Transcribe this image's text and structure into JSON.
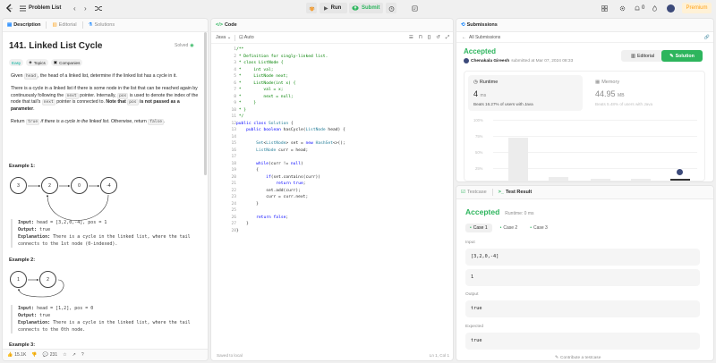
{
  "topbar": {
    "problem_list": "Problem List",
    "run": "Run",
    "submit": "Submit",
    "streak": "0",
    "premium": "Premium"
  },
  "left": {
    "tabs": [
      "Description",
      "Editorial",
      "Solutions"
    ],
    "title": "141. Linked List Cycle",
    "status": "Solved",
    "difficulty": "Easy",
    "chips": [
      "Topics",
      "Companies"
    ],
    "p1_a": "Given ",
    "p1_code": "head",
    "p1_b": ", the head of a linked list, determine if the linked list has a cycle in it.",
    "p2_a": "There is a cycle in a linked list if there is some node in the list that can be reached again by continuously following the ",
    "p2_code1": "next",
    "p2_b": " pointer. Internally, ",
    "p2_code2": "pos",
    "p2_c": " is used to denote the index of the node that tail's ",
    "p2_code3": "next",
    "p2_d": " pointer is connected to. ",
    "p2_bold_a": "Note that ",
    "p2_code4": "pos",
    "p2_bold_b": " is not passed as a parameter",
    "p2_e": ".",
    "p3_a": "Return ",
    "p3_code1": "true",
    "p3_b": " if there is a cycle in the linked list",
    "p3_c": ". Otherwise, return ",
    "p3_code2": "false",
    "p3_d": ".",
    "ex1_title": "Example 1:",
    "ex1_nodes": [
      "3",
      "2",
      "0",
      "-4"
    ],
    "ex1_input_label": "Input:",
    "ex1_input": "head = [3,2,0,-4], pos = 1",
    "ex1_output_label": "Output:",
    "ex1_output": "true",
    "ex1_expl_label": "Explanation:",
    "ex1_expl": "There is a cycle in the linked list, where the tail connects to the 1st node (0-indexed).",
    "ex2_title": "Example 2:",
    "ex2_nodes": [
      "1",
      "2"
    ],
    "ex2_input": "head = [1,2], pos = 0",
    "ex2_output": "true",
    "ex2_expl": "There is a cycle in the linked list, where the tail connects to the 0th node.",
    "ex3_title": "Example 3:",
    "likes": "15.1K",
    "comments": "231"
  },
  "code": {
    "tab": "Code",
    "language": "Java",
    "mode": "Auto",
    "lines": [
      "/**",
      " * Definition for singly-linked list.",
      " * class ListNode {",
      " *     int val;",
      " *     ListNode next;",
      " *     ListNode(int x) {",
      " *         val = x;",
      " *         next = null;",
      " *     }",
      " * }",
      " */",
      "public class Solution {",
      "    public boolean hasCycle(ListNode head) {",
      "",
      "        Set<ListNode> set = new HashSet<>();",
      "        ListNode curr = head;",
      "",
      "        while(curr != null)",
      "        {",
      "            if(set.contains(curr))",
      "                return true;",
      "            set.add(curr);",
      "            curr = curr.next;",
      "        }",
      "",
      "        return false;",
      "    }",
      "}"
    ],
    "saved": "Saved to local",
    "cursor": "Ln 1, Col 1"
  },
  "submissions": {
    "tab": "Submissions",
    "back": "All Submissions",
    "status": "Accepted",
    "user": "Chenakala Gireesh",
    "submitted": "submitted at Mar 07, 2024 08:33",
    "editorial": "Editorial",
    "solution": "Solution",
    "runtime_label": "Runtime",
    "runtime_value": "4",
    "runtime_unit": "ms",
    "runtime_beats": "Beats 16.27% of users with Java",
    "memory_label": "Memory",
    "memory_value": "44.95",
    "memory_unit": "MB",
    "memory_beats": "Beats 5.48% of users with Java",
    "y_ticks": [
      "100%",
      "75%",
      "50%",
      "25%",
      "0%"
    ]
  },
  "result": {
    "tabs": [
      "Testcase",
      "Test Result"
    ],
    "status": "Accepted",
    "runtime": "Runtime: 0 ms",
    "cases": [
      "Case 1",
      "Case 2",
      "Case 3"
    ],
    "input_label": "Input",
    "input_head": "[3,2,0,-4]",
    "input_pos": "1",
    "output_label": "Output",
    "output": "true",
    "expected_label": "Expected",
    "expected": "true",
    "contribute": "Contribute a testcase"
  },
  "colors": {
    "accent_green": "#2db55d",
    "orange": "#ffa116",
    "blue": "#007aff"
  }
}
